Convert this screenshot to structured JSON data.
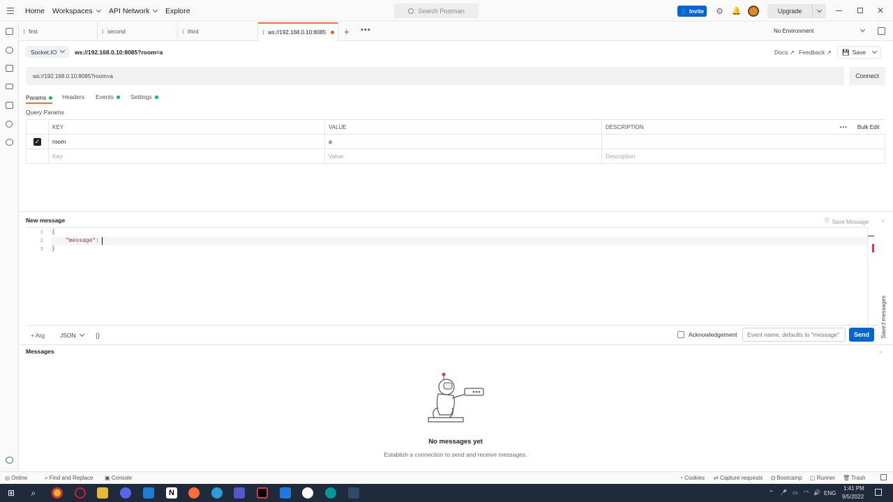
{
  "topbar": {
    "nav": [
      "Home",
      "Workspaces",
      "API Network",
      "Explore"
    ],
    "search_placeholder": "Search Postman",
    "invite": "Invite",
    "upgrade": "Upgrade"
  },
  "tabs": [
    {
      "label": "first"
    },
    {
      "label": "second"
    },
    {
      "label": "third"
    },
    {
      "label": "ws://192.168.0.10:8085"
    }
  ],
  "environment": "No Environment",
  "request": {
    "type": "Socket.IO",
    "title": "ws://192.168.0.10:8085?room=a",
    "docs": "Docs ↗",
    "feedback": "Feedback ↗",
    "save": "Save",
    "url": "ws://192.168.0.10:8085?room=a",
    "connect": "Connect"
  },
  "subtabs": [
    "Params",
    "Headers",
    "Events",
    "Settings"
  ],
  "query_params": {
    "title": "Query Params",
    "headers": [
      "KEY",
      "VALUE",
      "DESCRIPTION"
    ],
    "bulk_edit": "Bulk Edit",
    "rows": [
      {
        "key": "room",
        "value": "a",
        "description": ""
      }
    ],
    "placeholders": {
      "key": "Key",
      "value": "Value",
      "description": "Description"
    }
  },
  "message": {
    "title": "New message",
    "save_message": "Save Message",
    "lines": [
      "{",
      "\"message\":",
      "}"
    ],
    "line_numbers": [
      "1",
      "2",
      "3"
    ],
    "arg": "+ Arg",
    "format": "JSON",
    "braces": "{}",
    "acknowledgement": "Acknowledgement",
    "event_placeholder": "Event name, defaults to \"message\"",
    "send": "Send",
    "saved_messages": "Saved messages"
  },
  "messages": {
    "title": "Messages",
    "empty_title": "No messages yet",
    "empty_sub": "Establish a connection to send and receive messages."
  },
  "statusbar": {
    "online": "Online",
    "find_replace": "Find and Replace",
    "console": "Console",
    "cookies": "Cookies",
    "capture": "Capture requests",
    "bootcamp": "Bootcamp",
    "runner": "Runner",
    "trash": "Trash"
  },
  "taskbar": {
    "lang": "ENG",
    "time": "1:41 PM",
    "date": "9/5/2022"
  },
  "colors": {
    "accent": "#ff6c37",
    "blue": "#0265d2",
    "green": "#0cbb52"
  }
}
